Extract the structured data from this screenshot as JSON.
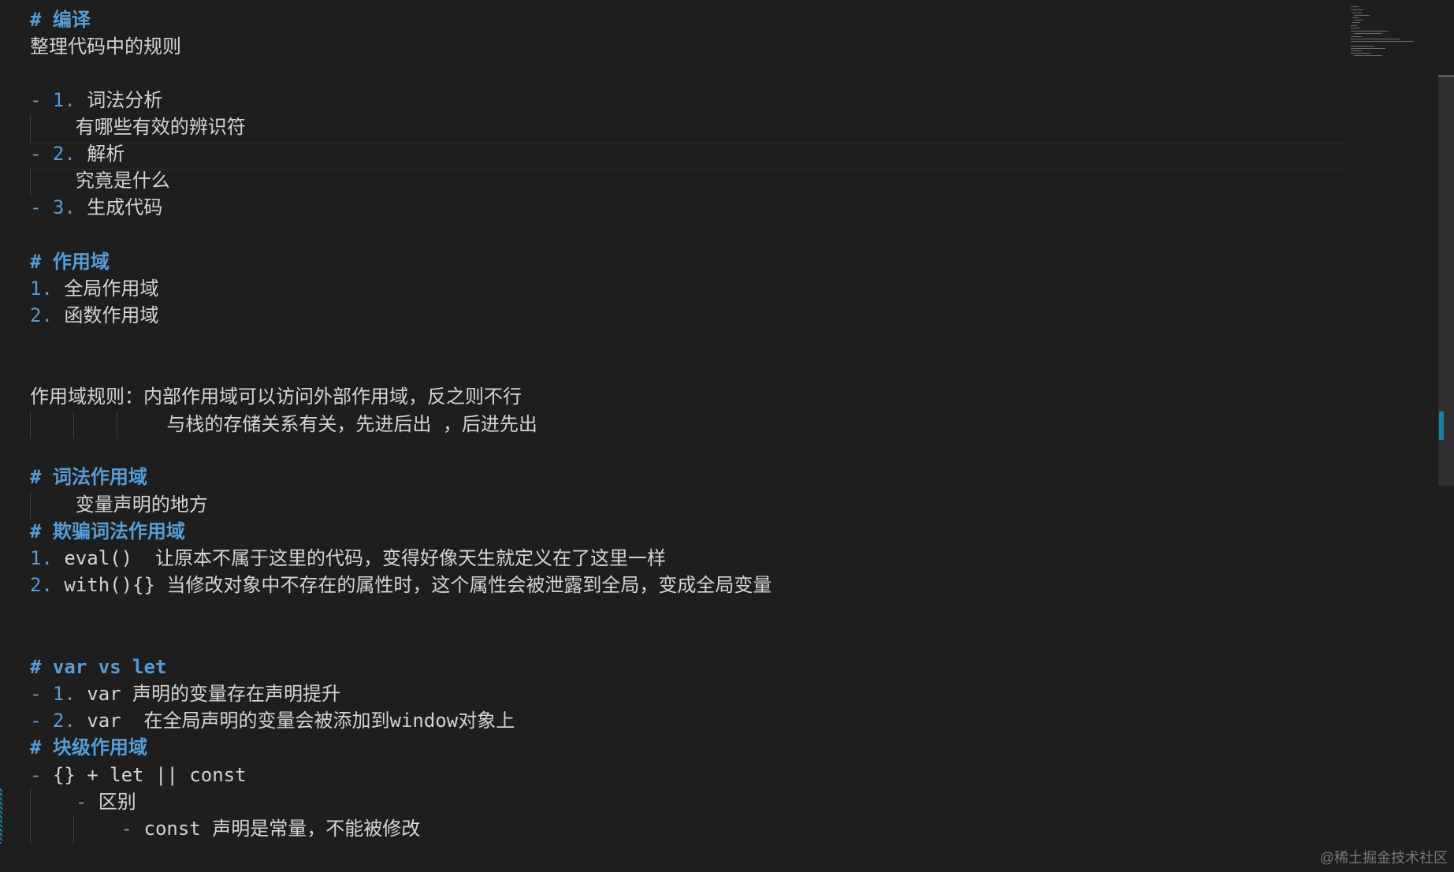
{
  "lines": [
    {
      "parts": [
        {
          "t": "# 编译",
          "c": "h"
        }
      ]
    },
    {
      "parts": [
        {
          "t": "整理代码中的规则",
          "c": "tx"
        }
      ]
    },
    {
      "parts": [
        {
          "t": "- 1. ",
          "c": "mk"
        },
        {
          "t": "词法分析",
          "c": "tx"
        }
      ]
    },
    {
      "parts": [
        {
          "t": "    有哪些有效的辨识符",
          "c": "tx"
        }
      ]
    },
    {
      "parts": [
        {
          "t": "- 2. ",
          "c": "mk"
        },
        {
          "t": "解析",
          "c": "tx"
        }
      ]
    },
    {
      "parts": [
        {
          "t": "    究竟是什么",
          "c": "tx"
        }
      ]
    },
    {
      "parts": [
        {
          "t": "- 3. ",
          "c": "mk"
        },
        {
          "t": "生成代码",
          "c": "tx"
        }
      ]
    },
    {
      "parts": [
        {
          "t": "# 作用域",
          "c": "h"
        }
      ]
    },
    {
      "parts": [
        {
          "t": "1. ",
          "c": "mk"
        },
        {
          "t": "全局作用域",
          "c": "tx"
        }
      ]
    },
    {
      "parts": [
        {
          "t": "2. ",
          "c": "mk"
        },
        {
          "t": "函数作用域",
          "c": "tx"
        }
      ]
    },
    {
      "parts": [
        {
          "t": "作用域规则：内部作用域可以访问外部作用域，反之则不行",
          "c": "tx"
        }
      ]
    },
    {
      "parts": [
        {
          "t": "            与栈的存储关系有关，先进后出 ，后进先出",
          "c": "tx"
        }
      ]
    },
    {
      "parts": [
        {
          "t": "# 词法作用域",
          "c": "h"
        }
      ]
    },
    {
      "parts": [
        {
          "t": "    变量声明的地方",
          "c": "tx"
        }
      ]
    },
    {
      "parts": [
        {
          "t": "# 欺骗词法作用域",
          "c": "h"
        }
      ]
    },
    {
      "parts": [
        {
          "t": "1. ",
          "c": "mk"
        },
        {
          "t": "eval()  让原本不属于这里的代码，变得好像天生就定义在了这里一样",
          "c": "tx"
        }
      ]
    },
    {
      "parts": [
        {
          "t": "2. ",
          "c": "mk"
        },
        {
          "t": "with(){} 当修改对象中不存在的属性时，这个属性会被泄露到全局，变成全局变量",
          "c": "tx"
        }
      ]
    },
    {
      "parts": [
        {
          "t": "# var vs let",
          "c": "h"
        }
      ]
    },
    {
      "parts": [
        {
          "t": "- 1. ",
          "c": "mk"
        },
        {
          "t": "var 声明的变量存在声明提升",
          "c": "tx"
        }
      ]
    },
    {
      "parts": [
        {
          "t": "- 2. ",
          "c": "mk"
        },
        {
          "t": "var  在全局声明的变量会被添加到window对象上",
          "c": "tx"
        }
      ]
    },
    {
      "parts": [
        {
          "t": "# 块级作用域",
          "c": "h"
        }
      ]
    },
    {
      "parts": [
        {
          "t": "- ",
          "c": "mk"
        },
        {
          "t": "{} + let || const",
          "c": "tx"
        }
      ]
    },
    {
      "parts": [
        {
          "t": "    - ",
          "c": "mk"
        },
        {
          "t": "区别",
          "c": "tx"
        }
      ]
    },
    {
      "parts": [
        {
          "t": "        - ",
          "c": "mk"
        },
        {
          "t": "const 声明是常量，不能被修改",
          "c": "tx"
        }
      ]
    }
  ],
  "watermark": "@稀土掘金技术社区"
}
